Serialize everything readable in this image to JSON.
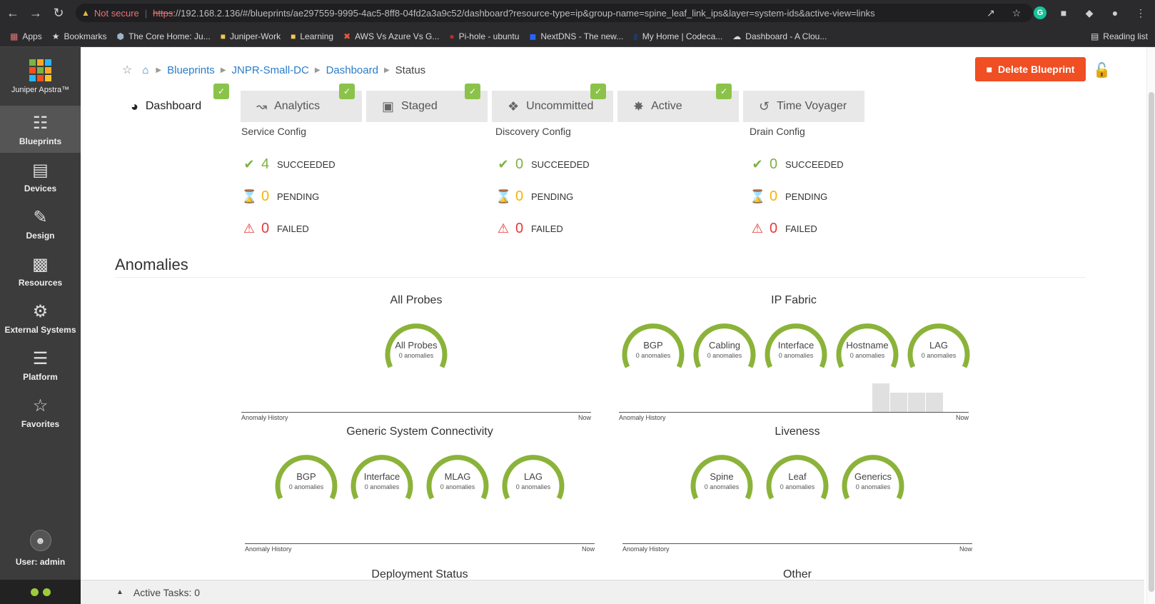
{
  "browser": {
    "security_warning": "Not secure",
    "url_scheme": "https",
    "url_rest": "://192.168.2.136/#/blueprints/ae297559-9995-4ac5-8ff8-04fd2a3a9c52/dashboard?resource-type=ip&group-name=spine_leaf_link_ips&layer=system-ids&active-view=links",
    "bookmarks": [
      "Apps",
      "Bookmarks",
      "The Core Home: Ju...",
      "Juniper-Work",
      "Learning",
      "AWS Vs Azure Vs G...",
      "Pi-hole - ubuntu",
      "NextDNS - The new...",
      "My Home | Codeca...",
      "Dashboard - A Clou..."
    ],
    "reading_list": "Reading list"
  },
  "sidebar": {
    "logo": "Juniper Apstra™",
    "items": [
      {
        "label": "Blueprints",
        "icon": "blueprints-icon"
      },
      {
        "label": "Devices",
        "icon": "devices-icon"
      },
      {
        "label": "Design",
        "icon": "design-icon"
      },
      {
        "label": "Resources",
        "icon": "resources-icon"
      },
      {
        "label": "External Systems",
        "icon": "external-systems-icon"
      },
      {
        "label": "Platform",
        "icon": "platform-icon"
      },
      {
        "label": "Favorites",
        "icon": "star-icon"
      }
    ],
    "user": "User: admin"
  },
  "breadcrumb": {
    "blueprints": "Blueprints",
    "blueprint": "JNPR-Small-DC",
    "dashboard": "Dashboard",
    "current": "Status"
  },
  "actions": {
    "delete": "Delete Blueprint"
  },
  "tabs": [
    {
      "label": "Dashboard"
    },
    {
      "label": "Analytics"
    },
    {
      "label": "Staged"
    },
    {
      "label": "Uncommitted"
    },
    {
      "label": "Active"
    },
    {
      "label": "Time Voyager"
    }
  ],
  "status": [
    {
      "title": "Service Config",
      "succeeded": "4",
      "pending": "0",
      "failed": "0"
    },
    {
      "title": "Discovery Config",
      "succeeded": "0",
      "pending": "0",
      "failed": "0"
    },
    {
      "title": "Drain Config",
      "succeeded": "0",
      "pending": "0",
      "failed": "0"
    }
  ],
  "status_labels": {
    "succeeded": "SUCCEEDED",
    "pending": "PENDING",
    "failed": "FAILED"
  },
  "anomalies": {
    "title": "Anomalies",
    "history_label": "Anomaly History",
    "now_label": "Now",
    "zero": "0 anomalies",
    "groups": [
      {
        "title": "All Probes",
        "gauges": [
          "All Probes"
        ]
      },
      {
        "title": "IP Fabric",
        "gauges": [
          "BGP",
          "Cabling",
          "Interface",
          "Hostname",
          "LAG"
        ]
      },
      {
        "title": "Generic System Connectivity",
        "gauges": [
          "BGP",
          "Interface",
          "MLAG",
          "LAG"
        ]
      },
      {
        "title": "Liveness",
        "gauges": [
          "Spine",
          "Leaf",
          "Generics"
        ]
      }
    ],
    "next_groups": [
      "Deployment Status",
      "Other"
    ]
  },
  "footer": {
    "active_tasks": "Active Tasks: 0"
  },
  "colors": {
    "accent": "#f04e23",
    "ok": "#7cb342",
    "gauge": "#8bb33a",
    "link": "#2a7dc8"
  }
}
